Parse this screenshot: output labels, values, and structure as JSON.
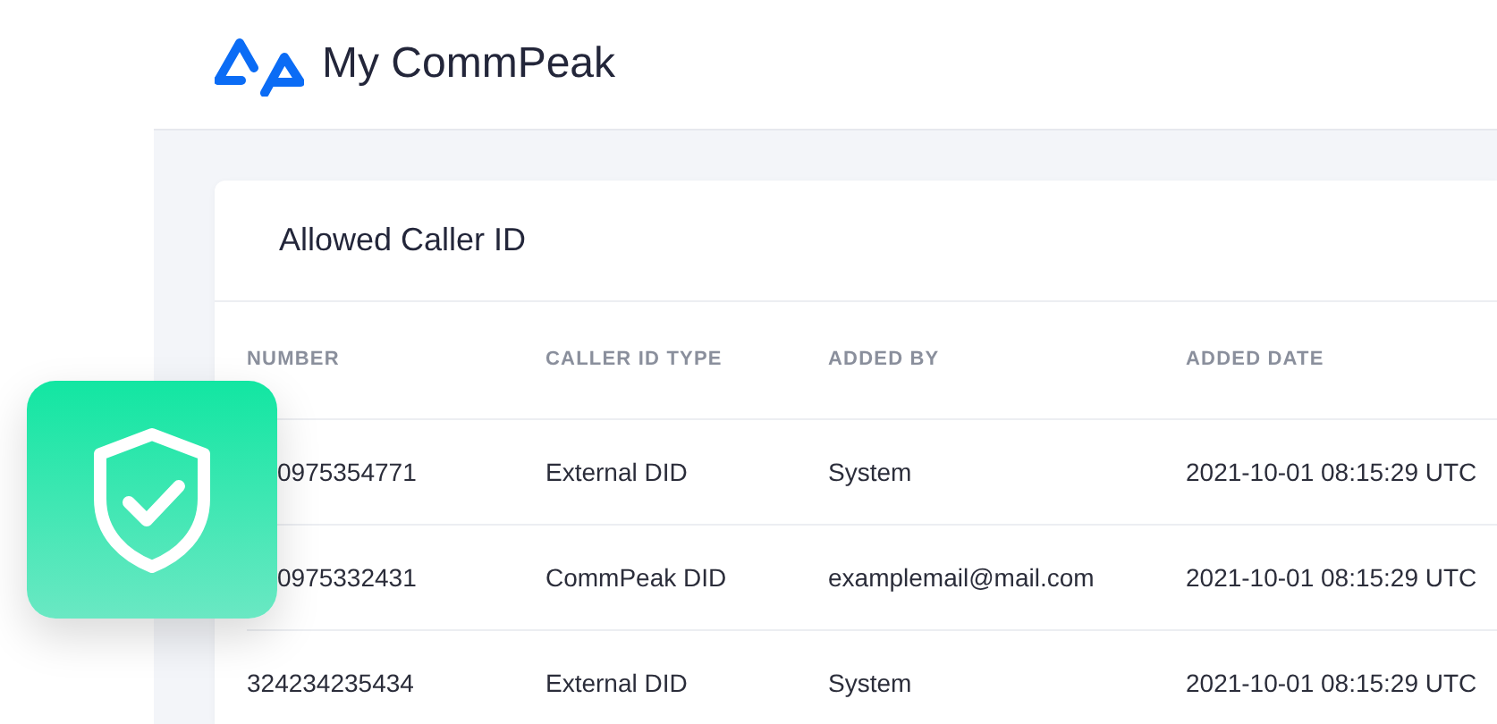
{
  "brand": {
    "name": "My CommPeak"
  },
  "card": {
    "title": "Allowed Caller ID"
  },
  "table": {
    "columns": [
      "NUMBER",
      "CALLER ID TYPE",
      "ADDED BY",
      "ADDED DATE"
    ],
    "rows": [
      {
        "cells": [
          "0975354771",
          "External DID",
          "System",
          "2021-10-01 08:15:29 UTC"
        ],
        "partly_hidden": true
      },
      {
        "cells": [
          "0975332431",
          "CommPeak DID",
          "examplemail@mail.com",
          "2021-10-01 08:15:29 UTC"
        ],
        "partly_hidden": true
      },
      {
        "cells": [
          "324234235434",
          "External DID",
          "System",
          "2021-10-01 08:15:29 UTC"
        ],
        "partly_hidden": false
      }
    ]
  }
}
